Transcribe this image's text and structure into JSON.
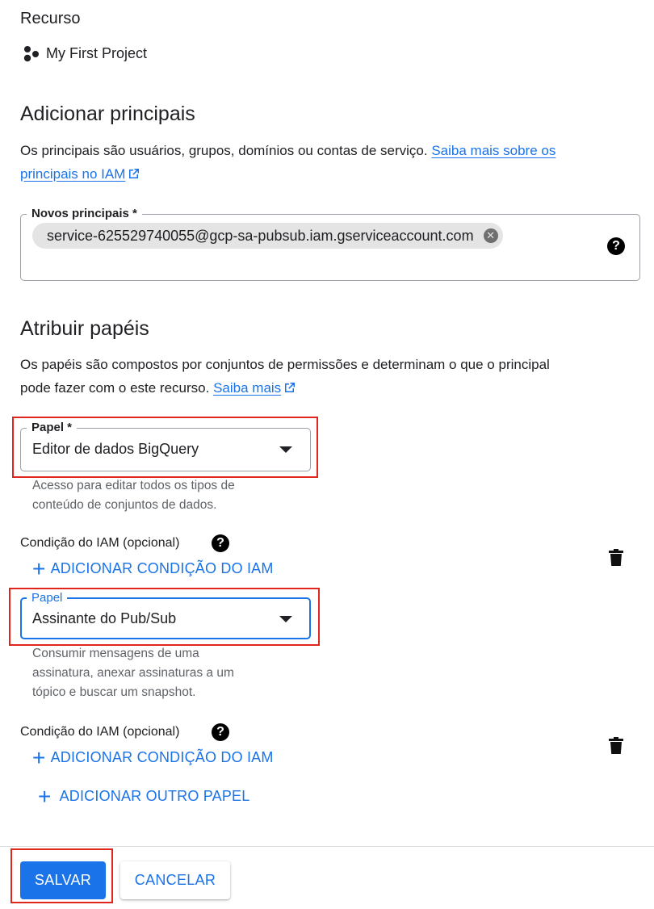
{
  "resource": {
    "label": "Recurso",
    "project_name": "My First Project",
    "project_icon": "project-dots-icon"
  },
  "add_principals": {
    "title": "Adicionar principais",
    "description": "Os principais são usuários, grupos, domínios ou contas de serviço.",
    "link_text_line1": "Saiba mais sobre os",
    "link_text_line2": "principais no IAM",
    "field_label": "Novos principais *",
    "chip_value": "service-625529740055@gcp-sa-pubsub.iam.gserviceaccount.com",
    "help_icon": "?"
  },
  "assign_roles": {
    "title": "Atribuir papéis",
    "description_line1": "Os papéis são compostos por conjuntos de permissões e determinam o que o principal",
    "description_line2": "pode fazer com o este recurso.",
    "link_text": "Saiba mais",
    "roles": [
      {
        "field_label": "Papel *",
        "value": "Editor de dados BigQuery",
        "hint_lines": [
          "Acesso para editar todos os tipos de",
          "conteúdo de conjuntos de dados."
        ],
        "condition_label": "Condição do IAM (opcional)",
        "add_condition_label": "ADICIONAR CONDIÇÃO DO IAM"
      },
      {
        "field_label": "Papel",
        "value": "Assinante do Pub/Sub",
        "hint_lines": [
          "Consumir mensagens de uma",
          "assinatura, anexar assinaturas a um",
          "tópico e buscar um snapshot."
        ],
        "condition_label": "Condição do IAM (opcional)",
        "add_condition_label": "ADICIONAR CONDIÇÃO DO IAM"
      }
    ],
    "add_role_label": "ADICIONAR OUTRO PAPEL"
  },
  "footer": {
    "save_label": "SALVAR",
    "cancel_label": "CANCELAR"
  },
  "colors": {
    "accent": "#1a73e8",
    "highlight_box": "#e0261c"
  }
}
